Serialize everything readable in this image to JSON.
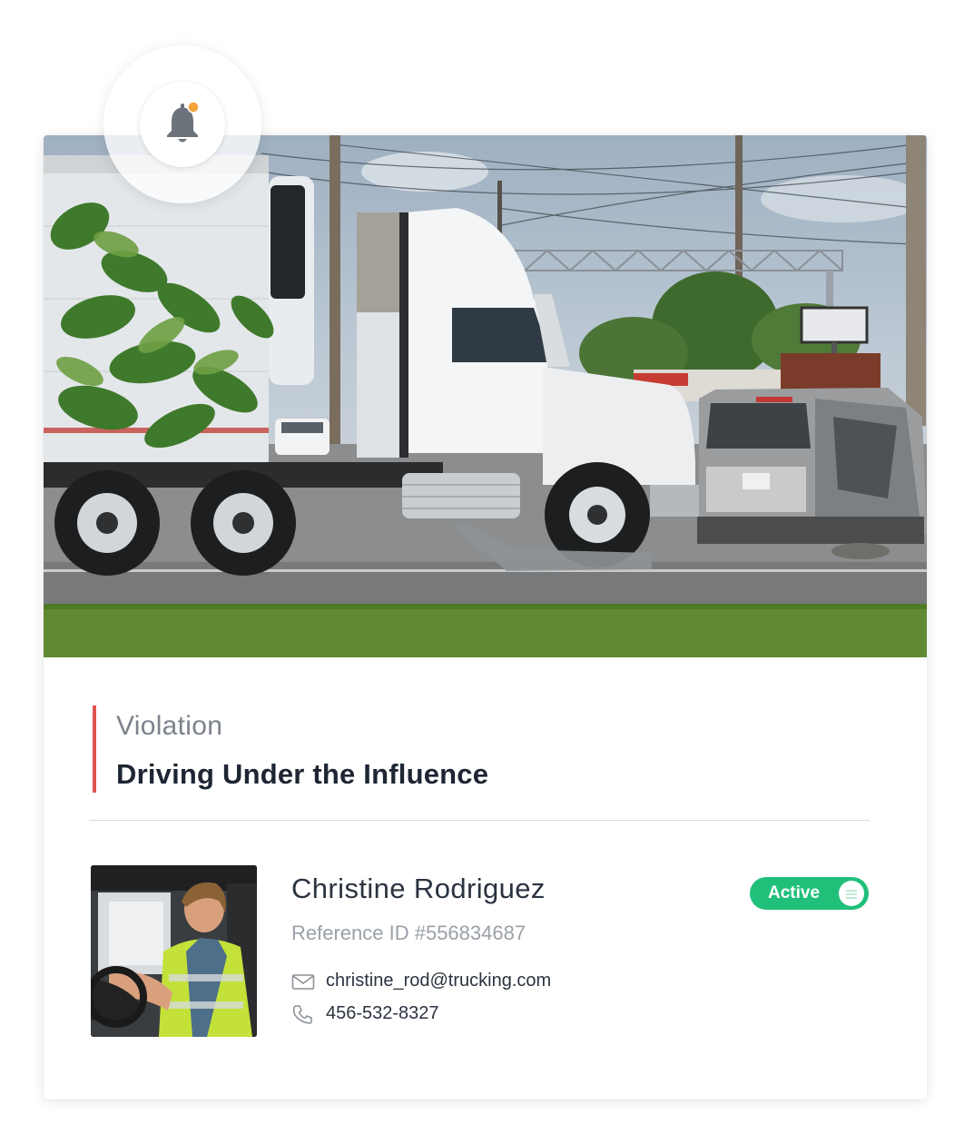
{
  "notification": {
    "icon": "bell-icon",
    "badge_color": "#f5a33b"
  },
  "violation": {
    "label": "Violation",
    "title": "Driving Under the Influence",
    "accent_color": "#e05252"
  },
  "driver": {
    "name": "Christine Rodriguez",
    "reference": "Reference ID #556834687",
    "email": "christine_rod@trucking.com",
    "phone": "456-532-8327",
    "email_icon": "envelope-icon",
    "phone_icon": "phone-icon"
  },
  "status": {
    "label": "Active",
    "color": "#21c07a"
  }
}
